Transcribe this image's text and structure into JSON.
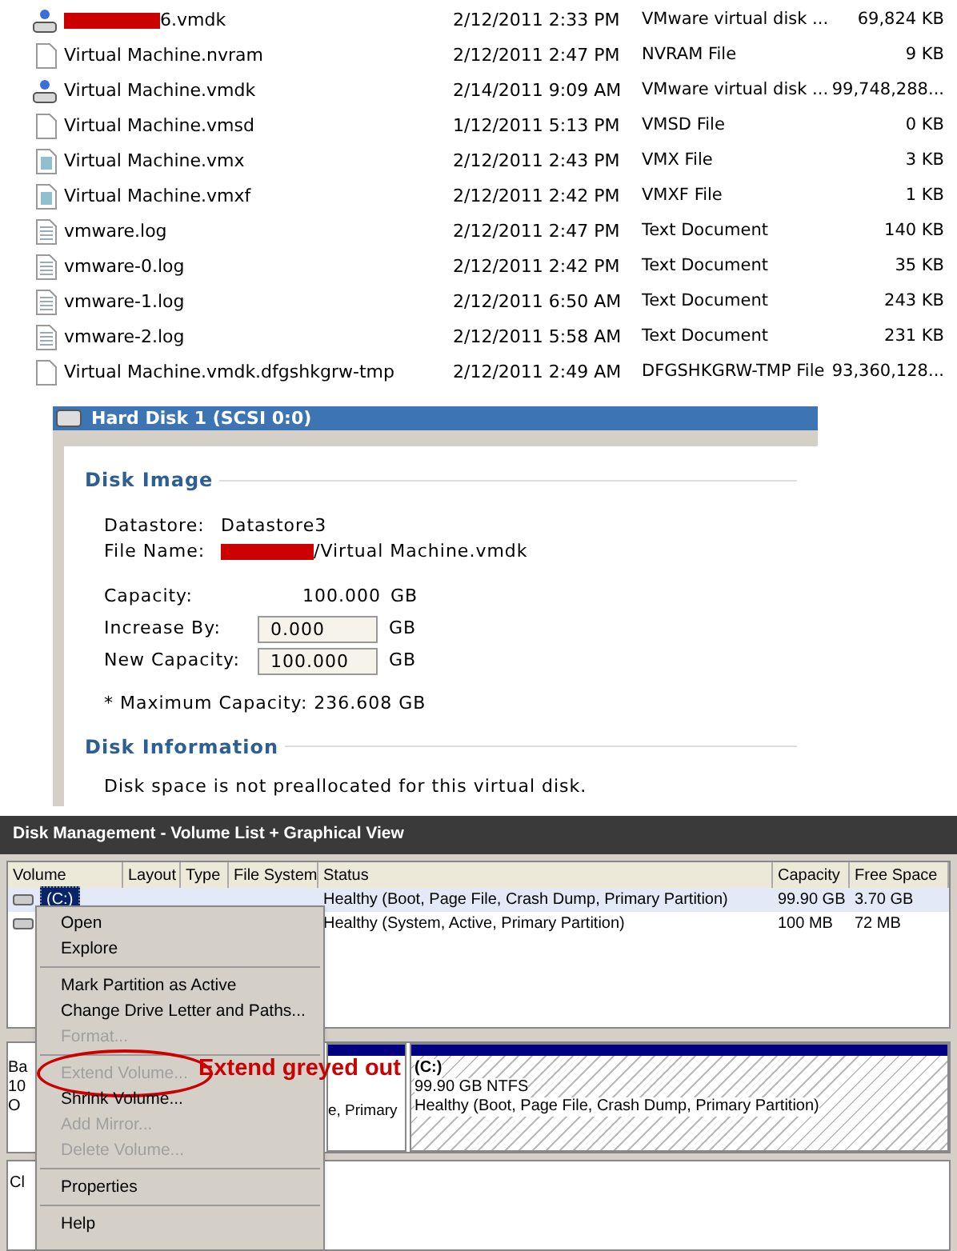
{
  "files": [
    {
      "kind": "disk",
      "name": "6.vmdk",
      "redacted": true,
      "date": "2/12/2011 2:33 PM",
      "type": "VMware virtual disk ...",
      "size": "69,824 KB"
    },
    {
      "kind": "blank",
      "name": "Virtual Machine.nvram",
      "redacted": false,
      "date": "2/12/2011 2:47 PM",
      "type": "NVRAM File",
      "size": "9 KB"
    },
    {
      "kind": "disk",
      "name": "Virtual Machine.vmdk",
      "redacted": false,
      "date": "2/14/2011 9:09 AM",
      "type": "VMware virtual disk ...",
      "size": "99,748,288..."
    },
    {
      "kind": "blank",
      "name": "Virtual Machine.vmsd",
      "redacted": false,
      "date": "1/12/2011 5:13 PM",
      "type": "VMSD File",
      "size": "0 KB"
    },
    {
      "kind": "config",
      "name": "Virtual Machine.vmx",
      "redacted": false,
      "date": "2/12/2011 2:43 PM",
      "type": "VMX File",
      "size": "3 KB"
    },
    {
      "kind": "config",
      "name": "Virtual Machine.vmxf",
      "redacted": false,
      "date": "2/12/2011 2:42 PM",
      "type": "VMXF File",
      "size": "1 KB"
    },
    {
      "kind": "text",
      "name": "vmware.log",
      "redacted": false,
      "date": "2/12/2011 2:47 PM",
      "type": "Text Document",
      "size": "140 KB"
    },
    {
      "kind": "text",
      "name": "vmware-0.log",
      "redacted": false,
      "date": "2/12/2011 2:42 PM",
      "type": "Text Document",
      "size": "35 KB"
    },
    {
      "kind": "text",
      "name": "vmware-1.log",
      "redacted": false,
      "date": "2/12/2011 6:50 AM",
      "type": "Text Document",
      "size": "243 KB"
    },
    {
      "kind": "text",
      "name": "vmware-2.log",
      "redacted": false,
      "date": "2/12/2011 5:58 AM",
      "type": "Text Document",
      "size": "231 KB"
    },
    {
      "kind": "blank",
      "name": "Virtual Machine.vmdk.dfgshkgrw-tmp",
      "redacted": false,
      "date": "2/12/2011 2:49 AM",
      "type": "DFGSHKGRW-TMP File",
      "size": "93,360,128..."
    }
  ],
  "disk_dialog": {
    "title": "Hard Disk 1 (SCSI 0:0)",
    "disk_image": {
      "heading": "Disk Image",
      "datastore_label": "Datastore:",
      "datastore": "Datastore3",
      "file_name_label": "File Name:",
      "file_name": "/Virtual Machine.vmdk",
      "capacity_label": "Capacity:",
      "capacity": "100.000",
      "capacity_unit": "GB",
      "increase_label": "Increase By:",
      "increase_value": "0.000",
      "increase_unit": "GB",
      "new_capacity_label": "New Capacity:",
      "new_capacity_value": "100.000",
      "new_capacity_unit": "GB",
      "max_capacity": "* Maximum Capacity: 236.608 GB"
    },
    "disk_information": {
      "heading": "Disk Information",
      "text": "Disk space is not preallocated for this virtual disk."
    }
  },
  "disk_management": {
    "title": "Disk Management - Volume List + Graphical View",
    "columns": [
      "Volume",
      "Layout",
      "Type",
      "File System",
      "Status",
      "Capacity",
      "Free Space"
    ],
    "rows": [
      {
        "volume": "(C:)",
        "selected": true,
        "status": "Healthy (Boot, Page File, Crash Dump, Primary Partition)",
        "capacity": "99.90 GB",
        "free_space": "3.70 GB"
      },
      {
        "selected": false,
        "status": "Healthy (System, Active, Primary Partition)",
        "capacity": "100 MB",
        "free_space": "72 MB"
      }
    ],
    "disk_labels": [
      "Ba",
      "10",
      "O"
    ],
    "partition_1_text": "e, Primary",
    "partition_2": {
      "name": "(C:)",
      "size": "99.90 GB NTFS",
      "status": "Healthy (Boot, Page File, Crash Dump, Primary Partition)"
    },
    "disk_2_label": "Cl",
    "context_menu": [
      {
        "kind": "item",
        "label": "Open",
        "disabled": false
      },
      {
        "kind": "item",
        "label": "Explore",
        "disabled": false
      },
      {
        "kind": "separator"
      },
      {
        "kind": "item",
        "label": "Mark Partition as Active",
        "disabled": false
      },
      {
        "kind": "item",
        "label": "Change Drive Letter and Paths...",
        "disabled": false
      },
      {
        "kind": "item",
        "label": "Format...",
        "disabled": true
      },
      {
        "kind": "separator"
      },
      {
        "kind": "item",
        "label": "Extend Volume...",
        "disabled": true,
        "circled": true
      },
      {
        "kind": "item",
        "label": "Shrink Volume...",
        "disabled": false
      },
      {
        "kind": "item",
        "label": "Add Mirror...",
        "disabled": true
      },
      {
        "kind": "item",
        "label": "Delete Volume...",
        "disabled": true
      },
      {
        "kind": "separator"
      },
      {
        "kind": "item",
        "label": "Properties",
        "disabled": false
      },
      {
        "kind": "separator"
      },
      {
        "kind": "item",
        "label": "Help",
        "disabled": false
      }
    ],
    "annotation": "Extend greyed out"
  }
}
